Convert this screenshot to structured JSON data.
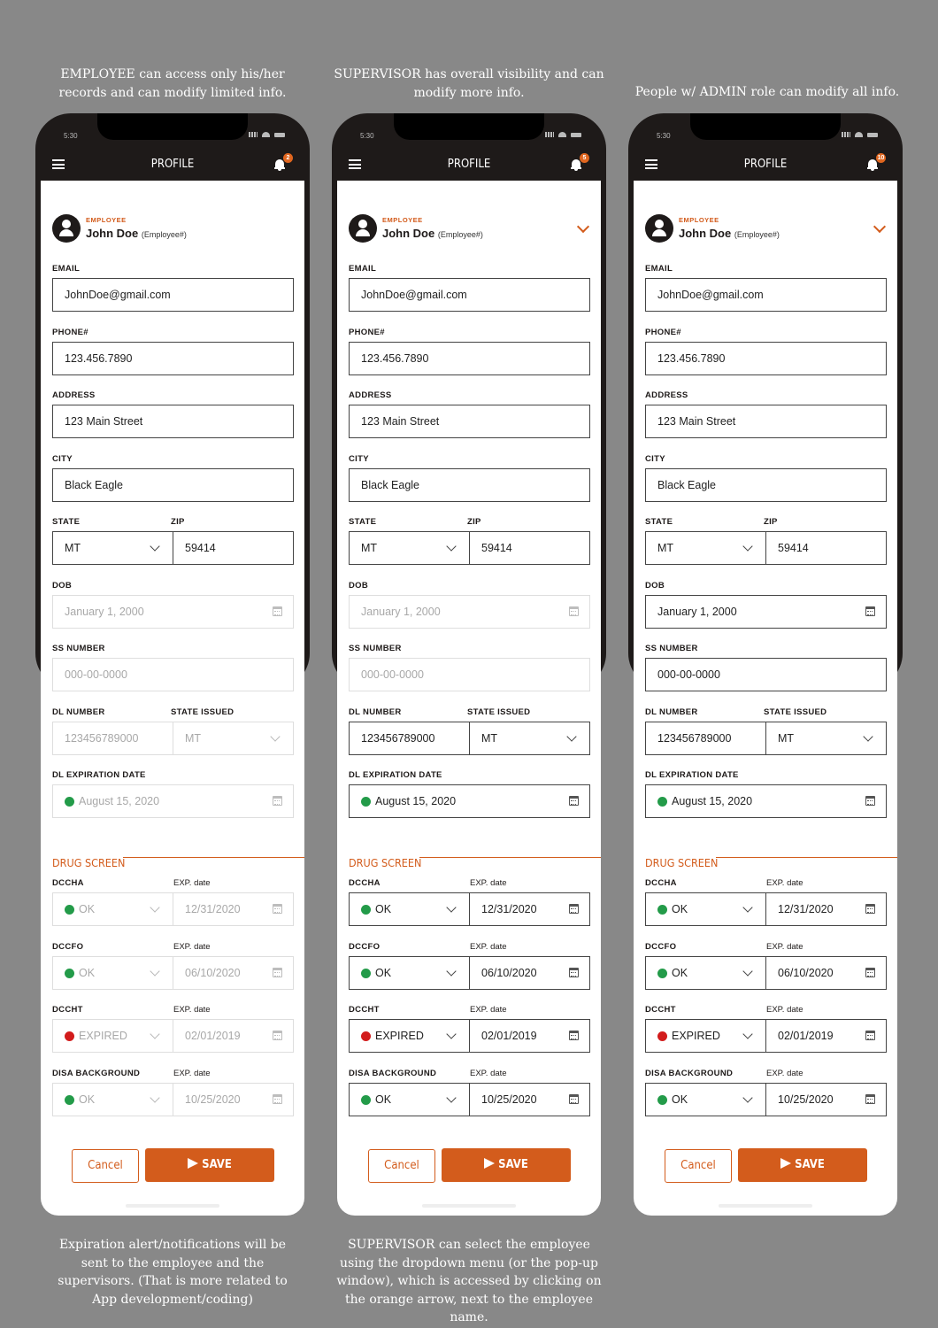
{
  "captions": {
    "top": [
      "EMPLOYEE can access only his/her records and can modify limited info.",
      "SUPERVISOR has overall visibility and can modify more info.",
      "People w/ ADMIN role can modify all info."
    ],
    "bottom": [
      "Expiration alert/notifications will be sent to the employee and the supervisors. (That is more related to App development/coding)",
      "SUPERVISOR can select the employee using the dropdown menu (or the pop-up window), which is accessed by clicking on the orange arrow, next to the employee name."
    ]
  },
  "colors": {
    "accent": "#d35c1c",
    "ok": "#239b49",
    "expired": "#d21c1c",
    "dark": "#1e1a19"
  },
  "labels": {
    "app_title": "PROFILE",
    "role": "EMPLOYEE",
    "email": "EMAIL",
    "phone": "PHONE#",
    "address": "ADDRESS",
    "city": "CITY",
    "state": "STATE",
    "zip": "ZIP",
    "dob": "DOB",
    "ss": "SS NUMBER",
    "dl_number": "DL NUMBER",
    "state_issued": "STATE ISSUED",
    "dl_exp": "DL EXPIRATION DATE",
    "drug_screen": "DRUG SCREEN",
    "exp_date": "EXP. date",
    "cancel": "Cancel",
    "save": "SAVE"
  },
  "phones": [
    {
      "time": "5:30",
      "badge": "2"
    },
    {
      "time": "5:30",
      "badge": "5"
    },
    {
      "time": "5:30",
      "badge": "10"
    }
  ],
  "profile": {
    "name": "John Doe",
    "employee_no": "(Employee#)",
    "email": "JohnDoe@gmail.com",
    "phone": "123.456.7890",
    "address": "123 Main Street",
    "city": "Black Eagle",
    "state": "MT",
    "zip": "59414",
    "dob": "January 1, 2000",
    "ss": "000-00-0000",
    "dl_number": "123456789000",
    "state_issued": "MT",
    "dl_exp": "August 15, 2020"
  },
  "drug_screen": [
    {
      "name": "DCCHA",
      "status": "OK",
      "status_color": "green",
      "exp": "12/31/2020"
    },
    {
      "name": "DCCFO",
      "status": "OK",
      "status_color": "green",
      "exp": "06/10/2020"
    },
    {
      "name": "DCCHT",
      "status": "EXPIRED",
      "status_color": "red",
      "exp": "02/01/2019"
    },
    {
      "name": "DISA BACKGROUND",
      "status": "OK",
      "status_color": "green",
      "exp": "10/25/2020"
    }
  ]
}
